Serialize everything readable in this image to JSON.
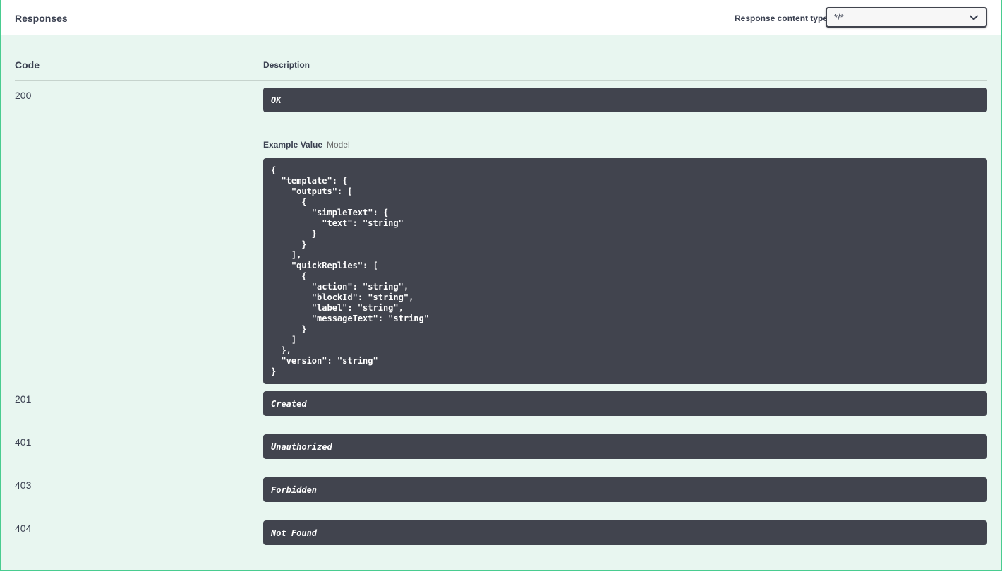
{
  "header": {
    "title": "Responses",
    "content_type_label": "Response content type",
    "content_type_value": "*/*"
  },
  "table": {
    "code_header": "Code",
    "description_header": "Description"
  },
  "responses": [
    {
      "code": "200",
      "description": "OK"
    },
    {
      "code": "201",
      "description": "Created"
    },
    {
      "code": "401",
      "description": "Unauthorized"
    },
    {
      "code": "403",
      "description": "Forbidden"
    },
    {
      "code": "404",
      "description": "Not Found"
    }
  ],
  "example": {
    "tab_example_value": "Example Value",
    "tab_model": "Model",
    "json": "{\n  \"template\": {\n    \"outputs\": [\n      {\n        \"simpleText\": {\n          \"text\": \"string\"\n        }\n      }\n    ],\n    \"quickReplies\": [\n      {\n        \"action\": \"string\",\n        \"blockId\": \"string\",\n        \"label\": \"string\",\n        \"messageText\": \"string\"\n      }\n    ]\n  },\n  \"version\": \"string\"\n}"
  },
  "colors": {
    "panel_border": "#49cc90",
    "panel_background": "#e8f6f0",
    "code_background": "#41444e",
    "text": "#3b4151"
  },
  "icons": {
    "select_arrow": "chevron-down-icon"
  }
}
